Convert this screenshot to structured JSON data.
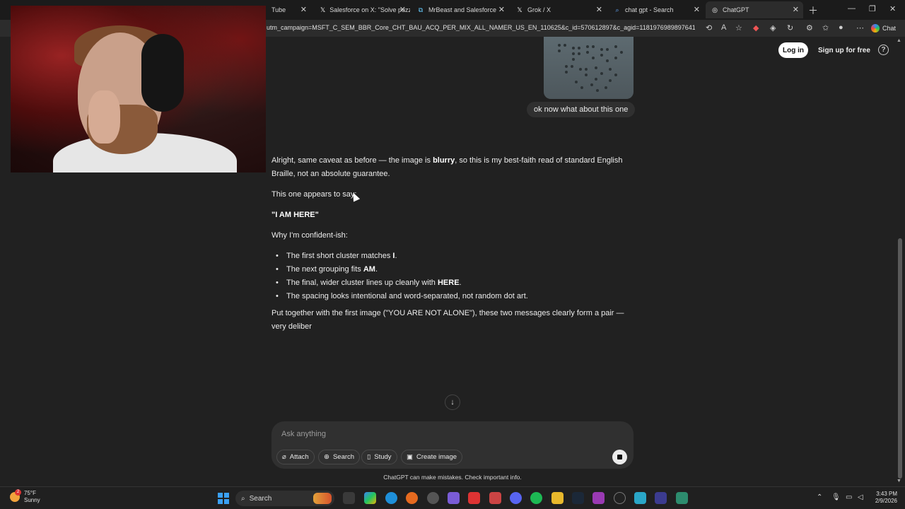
{
  "browser": {
    "tabs": [
      {
        "title": "Tube",
        "icon": "youtube-icon"
      },
      {
        "title": "Salesforce on X: \"Solve puzz",
        "icon": "x-logo-icon"
      },
      {
        "title": "MrBeast and Salesforce",
        "icon": "page-icon"
      },
      {
        "title": "Grok / X",
        "icon": "x-logo-icon"
      },
      {
        "title": "chat gpt - Search",
        "icon": "search-icon"
      },
      {
        "title": "ChatGPT",
        "icon": "chatgpt-icon",
        "active": true
      }
    ],
    "url": "utm_campaign=MSFT_C_SEM_BBR_Core_CHT_BAU_ACQ_PER_MIX_ALL_NAMER_US_EN_110625&c_id=570612897&c_agid=1181976989897641&c...",
    "copilot_label": "Chat"
  },
  "header": {
    "login_label": "Log in",
    "signup_label": "Sign up for free",
    "help_glyph": "?"
  },
  "conversation": {
    "user_message": "ok now what about this one",
    "assistant": {
      "intro_pre": "Alright, same caveat as before — the image is ",
      "intro_bold": "blurry",
      "intro_post": ", so this is my best-faith read of standard English Braille, not an absolute guarantee.",
      "appears": "This one appears to say:",
      "answer": "\"I AM HERE\"",
      "why": "Why I'm confident-ish:",
      "bullets": [
        {
          "pre": "The first short cluster matches ",
          "bold": "I",
          "post": "."
        },
        {
          "pre": "The next grouping fits ",
          "bold": "AM",
          "post": "."
        },
        {
          "pre": "The final, wider cluster lines up cleanly with ",
          "bold": "HERE",
          "post": "."
        },
        {
          "pre": "The spacing looks intentional and word-separated, not random dot art.",
          "bold": "",
          "post": ""
        }
      ],
      "closing": "Put together with the first image (\"YOU ARE NOT ALONE\"), these two messages clearly form a pair — very deliber"
    }
  },
  "composer": {
    "placeholder": "Ask anything",
    "attach_label": "Attach",
    "search_label": "Search",
    "study_label": "Study",
    "create_image_label": "Create image",
    "disclaimer": "ChatGPT can make mistakes. Check important info."
  },
  "taskbar": {
    "weather_temp": "75°F",
    "weather_cond": "Sunny",
    "weather_badge": "2",
    "search_label": "Search",
    "time": "3:43 PM",
    "date": "2/9/2026"
  }
}
